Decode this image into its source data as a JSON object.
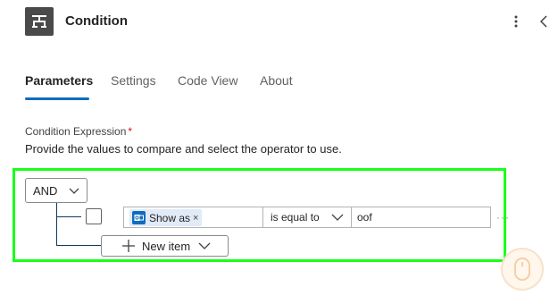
{
  "header": {
    "title": "Condition",
    "icon": "condition-icon",
    "more_icon": "more-vertical-icon",
    "collapse_icon": "chevron-left-icon"
  },
  "tabs": [
    {
      "label": "Parameters",
      "active": true
    },
    {
      "label": "Settings",
      "active": false
    },
    {
      "label": "Code View",
      "active": false
    },
    {
      "label": "About",
      "active": false
    }
  ],
  "condition": {
    "expression_label": "Condition Expression",
    "required_mark": "*",
    "description": "Provide the values to compare and select the operator to use.",
    "group_operator": "AND",
    "rows": [
      {
        "left_token": "Show as",
        "token_remove": "×",
        "operator": "is equal to",
        "right_value": "oof",
        "more": "···"
      }
    ],
    "new_item_label": "New item"
  },
  "colors": {
    "accent": "#0f6cbd",
    "highlight": "#19ff19",
    "required": "#c50f1f"
  }
}
